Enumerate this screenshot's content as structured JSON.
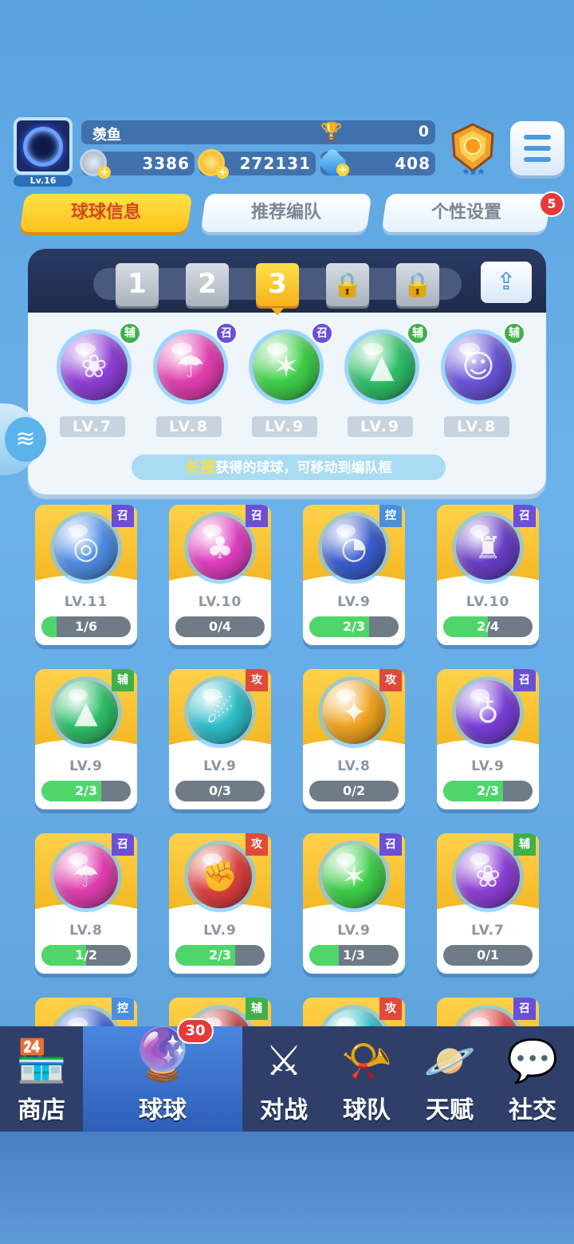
{
  "player": {
    "name": "羡鱼",
    "level": "Lv.16",
    "trophies": "0",
    "currency_silver": "3386",
    "currency_gold": "272131",
    "currency_gem": "408"
  },
  "tabs": [
    {
      "label": "球球信息",
      "active": true
    },
    {
      "label": "推荐编队",
      "active": false
    },
    {
      "label": "个性设置",
      "active": false
    }
  ],
  "tabs_badge": "5",
  "lineup": {
    "slots": [
      "1",
      "2",
      "3"
    ],
    "selected_slot": "3",
    "hint_highlight": "长按",
    "hint_rest": "获得的球球，可移动到编队框",
    "balls": [
      {
        "role": "辅",
        "level": "LV.7",
        "color": "#8e3fd6",
        "glyph": "❀"
      },
      {
        "role": "召",
        "level": "LV.8",
        "color": "#e23fb0",
        "glyph": "☂"
      },
      {
        "role": "召",
        "level": "LV.9",
        "color": "#3fcf4a",
        "glyph": "✶"
      },
      {
        "role": "辅",
        "level": "LV.9",
        "color": "#2fc06a",
        "glyph": "▲"
      },
      {
        "role": "辅",
        "level": "LV.8",
        "color": "#6a53d8",
        "glyph": "☺"
      }
    ]
  },
  "collection": [
    {
      "role": "召",
      "level": "LV.11",
      "progress": "1/6",
      "fill": 0.17,
      "color": "#4f8fe6",
      "glyph": "◎"
    },
    {
      "role": "召",
      "level": "LV.10",
      "progress": "0/4",
      "fill": 0.0,
      "color": "#e03fc0",
      "glyph": "♣"
    },
    {
      "role": "控",
      "level": "LV.9",
      "progress": "2/3",
      "fill": 0.67,
      "color": "#3b5fd0",
      "glyph": "◔"
    },
    {
      "role": "召",
      "level": "LV.10",
      "progress": "2/4",
      "fill": 0.5,
      "color": "#6a3fc8",
      "glyph": "♜"
    },
    {
      "role": "辅",
      "level": "LV.9",
      "progress": "2/3",
      "fill": 0.67,
      "color": "#2fc06a",
      "glyph": "▲"
    },
    {
      "role": "攻",
      "level": "LV.9",
      "progress": "0/3",
      "fill": 0.0,
      "color": "#2fbfc9",
      "glyph": "☄"
    },
    {
      "role": "攻",
      "level": "LV.8",
      "progress": "0/2",
      "fill": 0.0,
      "color": "#f0a520",
      "glyph": "✦"
    },
    {
      "role": "召",
      "level": "LV.9",
      "progress": "2/3",
      "fill": 0.67,
      "color": "#7a3fd8",
      "glyph": "♁"
    },
    {
      "role": "召",
      "level": "LV.8",
      "progress": "1/2",
      "fill": 0.5,
      "color": "#e23fb0",
      "glyph": "☂"
    },
    {
      "role": "攻",
      "level": "LV.9",
      "progress": "2/3",
      "fill": 0.67,
      "color": "#e04040",
      "glyph": "✊"
    },
    {
      "role": "召",
      "level": "LV.9",
      "progress": "1/3",
      "fill": 0.33,
      "color": "#3fcf4a",
      "glyph": "✶"
    },
    {
      "role": "辅",
      "level": "LV.7",
      "progress": "0/1",
      "fill": 0.0,
      "color": "#8e3fd6",
      "glyph": "❀"
    },
    {
      "role": "控",
      "level": "",
      "progress": "",
      "fill": 0.0,
      "color": "#3b5fd0",
      "glyph": ""
    },
    {
      "role": "辅",
      "level": "",
      "progress": "",
      "fill": 0.0,
      "color": "#c04040",
      "glyph": ""
    },
    {
      "role": "攻",
      "level": "",
      "progress": "",
      "fill": 0.0,
      "color": "#2fbfc9",
      "glyph": ""
    },
    {
      "role": "召",
      "level": "",
      "progress": "",
      "fill": 0.0,
      "color": "#e04040",
      "glyph": ""
    }
  ],
  "role_colors": {
    "召": "#6a4fd8",
    "辅": "#3fb04a",
    "控": "#4a8fe0",
    "攻": "#e04a3a"
  },
  "nav": [
    {
      "label": "商店",
      "icon": "shop-icon",
      "glyph": "🏪"
    },
    {
      "label": "球球",
      "icon": "ball-icon",
      "glyph": "🔮",
      "selected": true,
      "badge": "30"
    },
    {
      "label": "对战",
      "icon": "crossed-swords-icon",
      "glyph": "⚔"
    },
    {
      "label": "球队",
      "icon": "whistle-icon",
      "glyph": "📯"
    },
    {
      "label": "天赋",
      "icon": "planet-icon",
      "glyph": "🪐"
    },
    {
      "label": "社交",
      "icon": "chat-heart-icon",
      "glyph": "💬"
    }
  ]
}
